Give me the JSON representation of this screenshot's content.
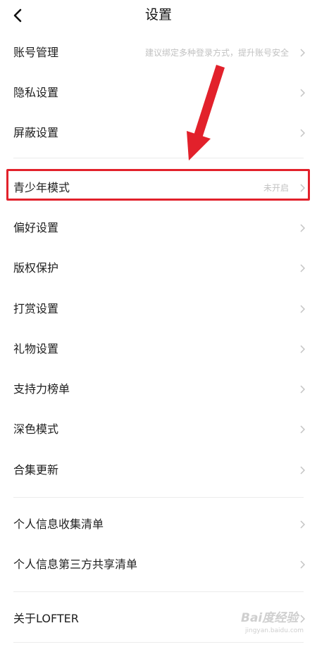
{
  "header": {
    "title": "设置",
    "back_icon": "chevron-left-icon"
  },
  "groups": [
    {
      "items": [
        {
          "label": "账号管理",
          "hint": "建议绑定多种登录方式，提升账号安全"
        },
        {
          "label": "隐私设置"
        },
        {
          "label": "屏蔽设置"
        }
      ]
    },
    {
      "items": [
        {
          "label": "青少年模式",
          "hint": "未开启",
          "highlighted": true
        },
        {
          "label": "偏好设置"
        },
        {
          "label": "版权保护"
        },
        {
          "label": "打赏设置"
        },
        {
          "label": "礼物设置"
        },
        {
          "label": "支持力榜单"
        },
        {
          "label": "深色模式"
        },
        {
          "label": "合集更新"
        }
      ]
    },
    {
      "items": [
        {
          "label": "个人信息收集清单"
        },
        {
          "label": "个人信息第三方共享清单"
        }
      ]
    },
    {
      "items": [
        {
          "label": "关于LOFTER"
        }
      ]
    }
  ],
  "colors": {
    "annotation_red": "#e2212b",
    "hint_gray": "#c2c2c2",
    "divider": "#ececec"
  },
  "watermark": {
    "main": "Bai度经验",
    "sub": "jingyan.baidu.com"
  }
}
